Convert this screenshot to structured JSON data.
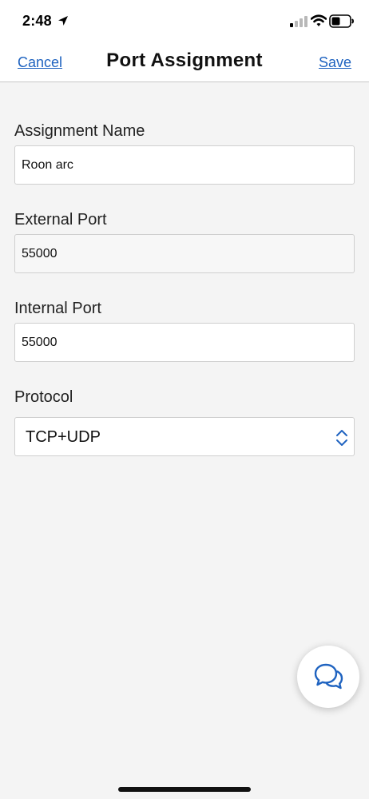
{
  "status_bar": {
    "time": "2:48",
    "icons": [
      "location-arrow-icon",
      "cellular-signal-icon",
      "wifi-icon",
      "battery-icon"
    ]
  },
  "nav": {
    "cancel_label": "Cancel",
    "title": "Port Assignment",
    "save_label": "Save"
  },
  "form": {
    "assignment_name": {
      "label": "Assignment Name",
      "value": "Roon arc"
    },
    "external_port": {
      "label": "External Port",
      "value": "55000"
    },
    "internal_port": {
      "label": "Internal Port",
      "value": "55000"
    },
    "protocol": {
      "label": "Protocol",
      "value": "TCP+UDP"
    }
  },
  "fab": {
    "icon": "chat-bubbles-icon"
  },
  "colors": {
    "accent": "#1f63c0",
    "background": "#f4f4f4",
    "surface": "#ffffff",
    "border": "#cfcfcf"
  }
}
